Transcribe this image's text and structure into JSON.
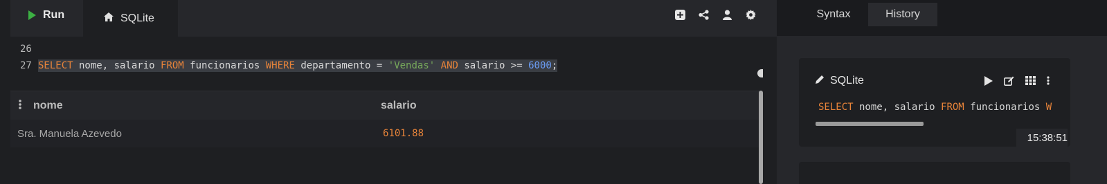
{
  "toolbar": {
    "run_label": "Run",
    "db_tab_label": "SQLite",
    "icons": [
      "add-icon",
      "share-icon",
      "user-icon",
      "settings-icon"
    ]
  },
  "editor": {
    "lines": [
      {
        "number": "26",
        "code": ""
      },
      {
        "number": "27",
        "code": "SELECT nome, salario FROM funcionarios WHERE departamento = 'Vendas' AND salario >= 6000;"
      }
    ],
    "tokens": {
      "select": "SELECT",
      "cols": " nome, salario ",
      "from": "FROM",
      "table": " funcionarios ",
      "where": "WHERE",
      "cond1": " departamento = ",
      "str_val": "'Vendas'",
      "space": " ",
      "and": "AND",
      "cond2": " salario >= ",
      "num_val": "6000",
      "semi": ";"
    }
  },
  "results": {
    "columns": [
      "nome",
      "salario"
    ],
    "rows": [
      {
        "nome": "Sra. Manuela Azevedo",
        "salario": "6101.88"
      }
    ]
  },
  "right_panel": {
    "tabs": [
      "Syntax",
      "History"
    ],
    "active_tab": "History",
    "history": [
      {
        "db": "SQLite",
        "sql_select": "SELECT",
        "sql_mid": " nome, salario ",
        "sql_from": "FROM",
        "sql_rest": " funcionarios ",
        "sql_cut": "W",
        "time": "15:38:51"
      }
    ]
  },
  "colors": {
    "keyword": "#e8843a",
    "string": "#77a95b",
    "number": "#6c9ef8",
    "run_green": "#3cb043",
    "value_orange": "#e8843a"
  }
}
